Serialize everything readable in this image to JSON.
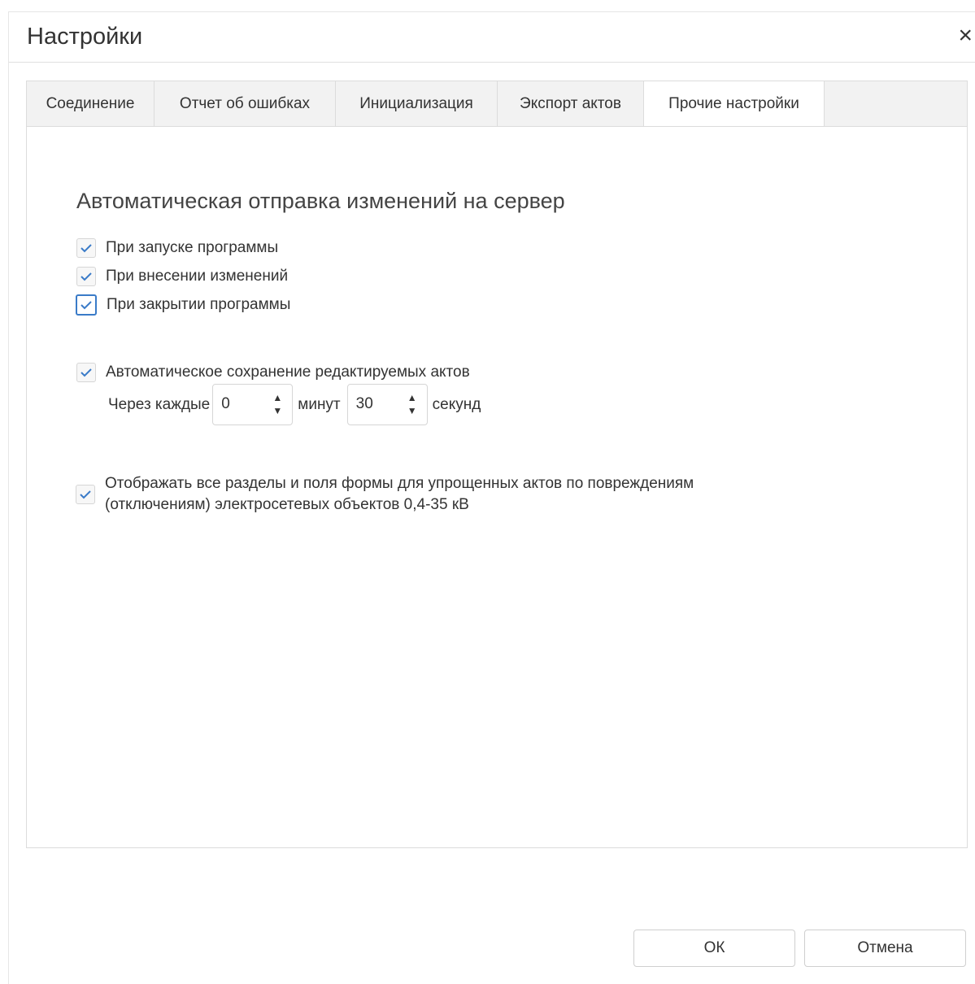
{
  "dialog": {
    "title": "Настройки",
    "close_glyph": "×",
    "close_icon": "close-icon"
  },
  "tabs": [
    {
      "label": "Соединение",
      "active": false
    },
    {
      "label": "Отчет об ошибках",
      "active": false
    },
    {
      "label": "Инициализация",
      "active": false
    },
    {
      "label": "Экспорт актов",
      "active": false
    },
    {
      "label": "Прочие настройки",
      "active": true
    }
  ],
  "other_settings": {
    "section_title": "Автоматическая отправка изменений на сервер",
    "send_options": [
      {
        "label": "При запуске программы",
        "checked": true
      },
      {
        "label": "При внесении изменений",
        "checked": true
      },
      {
        "label": "При закрытии программы",
        "checked": true,
        "focused": true
      }
    ],
    "autosave": {
      "label": "Автоматическое сохранение редактируемых актов",
      "checked": true,
      "prefix": "Через каждые",
      "minutes_value": "0",
      "minutes_label": "минут",
      "seconds_value": "30",
      "seconds_label": "секунд"
    },
    "show_all": {
      "line1": "Отображать все разделы и поля формы для упрощенных актов по повреждениям",
      "line2": "(отключениям) электросетевых объектов 0,4-35 кВ",
      "checked": true
    }
  },
  "buttons": {
    "ok": "ОК",
    "cancel": "Отмена"
  },
  "colors": {
    "checkmark": "#3a7bc8",
    "focus_border": "#3a7bc8",
    "tab_bar": "#f2f2f2"
  }
}
